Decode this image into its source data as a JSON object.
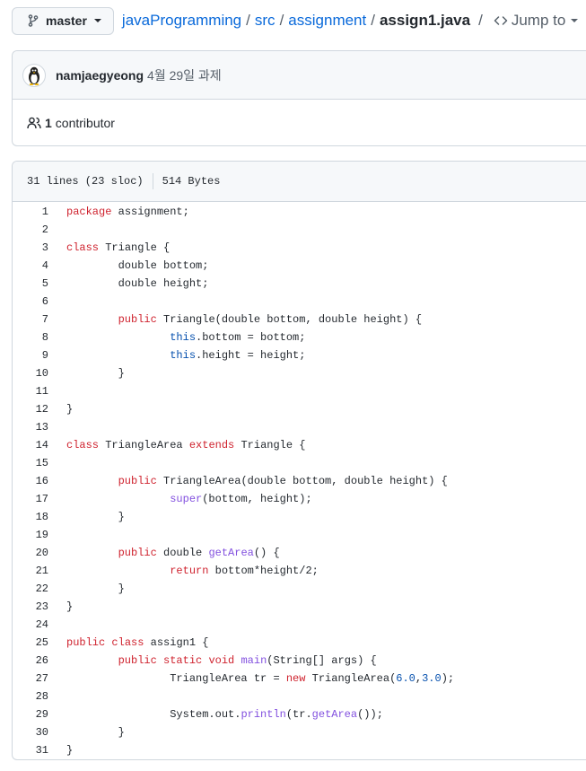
{
  "branch": {
    "label": "master"
  },
  "breadcrumb": {
    "repo": "javaProgramming",
    "dir1": "src",
    "dir2": "assignment",
    "file": "assign1.java",
    "jump_label": "Jump to"
  },
  "commit": {
    "author": "namjaegyeong",
    "message": "4월 29일 과제"
  },
  "contributors": {
    "count": "1",
    "label": "contributor"
  },
  "file_info": {
    "lines": "31 lines (23 sloc)",
    "size": "514 Bytes"
  },
  "code_lines": [
    [
      [
        "k",
        "package"
      ],
      [
        "p",
        " assignment;"
      ]
    ],
    [],
    [
      [
        "k",
        "class"
      ],
      [
        "p",
        " Triangle {"
      ]
    ],
    [
      [
        "p",
        "        double bottom;"
      ]
    ],
    [
      [
        "p",
        "        double height;"
      ]
    ],
    [],
    [
      [
        "p",
        "        "
      ],
      [
        "k",
        "public"
      ],
      [
        "p",
        " Triangle(double bottom, double height) {"
      ]
    ],
    [
      [
        "p",
        "                "
      ],
      [
        "s",
        "this"
      ],
      [
        "p",
        ".bottom = bottom;"
      ]
    ],
    [
      [
        "p",
        "                "
      ],
      [
        "s",
        "this"
      ],
      [
        "p",
        ".height = height;"
      ]
    ],
    [
      [
        "p",
        "        }"
      ]
    ],
    [],
    [
      [
        "p",
        "}"
      ]
    ],
    [],
    [
      [
        "k",
        "class"
      ],
      [
        "p",
        " TriangleArea "
      ],
      [
        "k",
        "extends"
      ],
      [
        "p",
        " Triangle {"
      ]
    ],
    [],
    [
      [
        "p",
        "        "
      ],
      [
        "k",
        "public"
      ],
      [
        "p",
        " TriangleArea(double bottom, double height) {"
      ]
    ],
    [
      [
        "p",
        "                "
      ],
      [
        "e",
        "super"
      ],
      [
        "p",
        "(bottom, height);"
      ]
    ],
    [
      [
        "p",
        "        }"
      ]
    ],
    [],
    [
      [
        "p",
        "        "
      ],
      [
        "k",
        "public"
      ],
      [
        "p",
        " double "
      ],
      [
        "e",
        "getArea"
      ],
      [
        "p",
        "() {"
      ]
    ],
    [
      [
        "p",
        "                "
      ],
      [
        "k",
        "return"
      ],
      [
        "p",
        " bottom*height/2;"
      ]
    ],
    [
      [
        "p",
        "        }"
      ]
    ],
    [
      [
        "p",
        "}"
      ]
    ],
    [],
    [
      [
        "k",
        "public"
      ],
      [
        "p",
        " "
      ],
      [
        "k",
        "class"
      ],
      [
        "p",
        " assign1 {"
      ]
    ],
    [
      [
        "p",
        "        "
      ],
      [
        "k",
        "public"
      ],
      [
        "p",
        " "
      ],
      [
        "k",
        "static"
      ],
      [
        "p",
        " "
      ],
      [
        "k",
        "void"
      ],
      [
        "p",
        " "
      ],
      [
        "e",
        "main"
      ],
      [
        "p",
        "(String[] args) {"
      ]
    ],
    [
      [
        "p",
        "                TriangleArea tr = "
      ],
      [
        "k",
        "new"
      ],
      [
        "p",
        " TriangleArea("
      ],
      [
        "s",
        "6.0"
      ],
      [
        "p",
        ","
      ],
      [
        "s",
        "3.0"
      ],
      [
        "p",
        ");"
      ]
    ],
    [],
    [
      [
        "p",
        "                System.out."
      ],
      [
        "e",
        "println"
      ],
      [
        "p",
        "(tr."
      ],
      [
        "e",
        "getArea"
      ],
      [
        "p",
        "());"
      ]
    ],
    [
      [
        "p",
        "        }"
      ]
    ],
    [
      [
        "p",
        "}"
      ]
    ]
  ]
}
